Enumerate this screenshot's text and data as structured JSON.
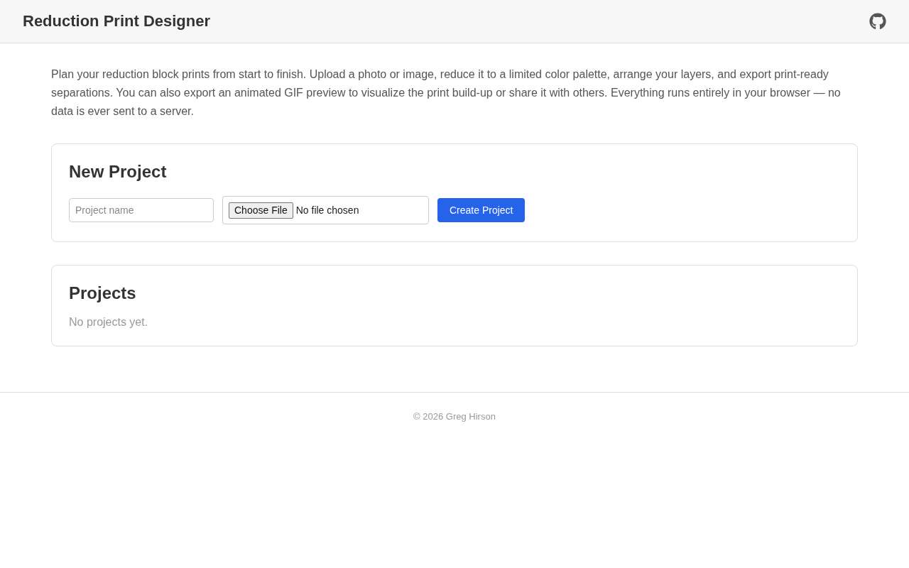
{
  "header": {
    "title": "Reduction Print Designer"
  },
  "intro": "Plan your reduction block prints from start to finish. Upload a photo or image, reduce it to a limited color palette, arrange your layers, and export print-ready separations. You can also export an animated GIF preview to visualize the print build-up or share it with others. Everything runs entirely in your browser — no data is ever sent to a server.",
  "new_project": {
    "heading": "New Project",
    "name_field": {
      "placeholder": "Project name"
    },
    "file_picker": {
      "button": "Choose File",
      "status": "No file chosen"
    },
    "create_button": "Create Project"
  },
  "projects": {
    "heading": "Projects",
    "empty_message": "No projects yet."
  },
  "footer": {
    "text": "© 2026 Greg Hirson"
  }
}
